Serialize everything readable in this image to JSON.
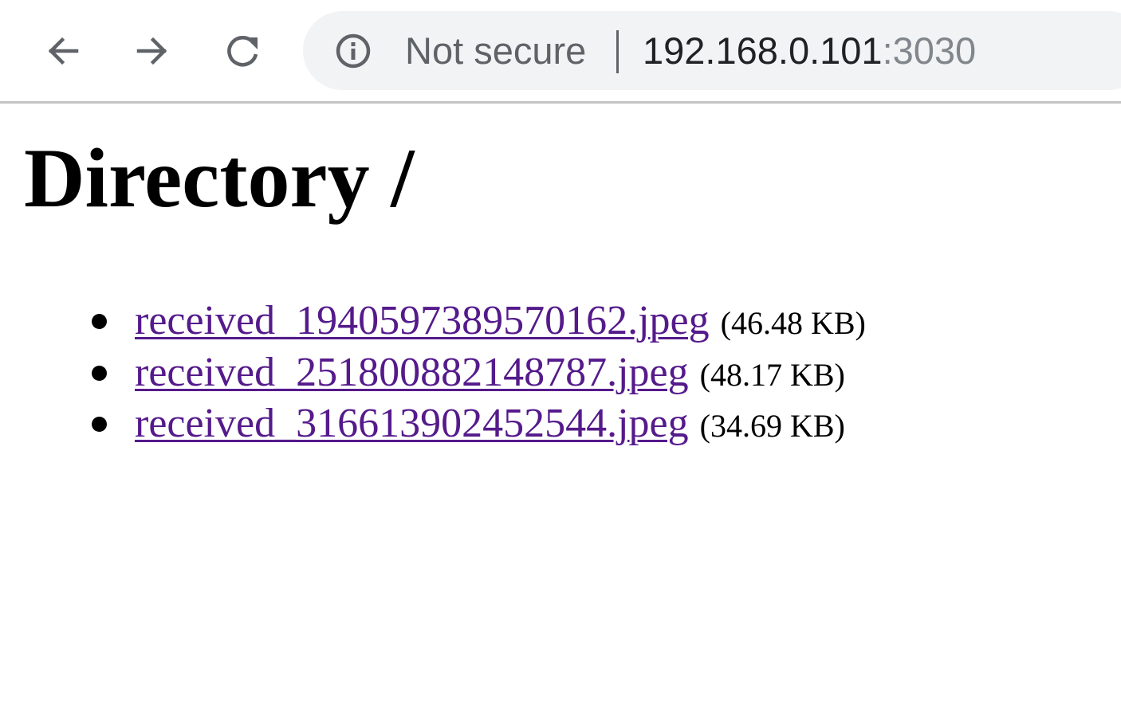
{
  "browser": {
    "security_label": "Not secure",
    "url_host": "192.168.0.101",
    "url_port": ":3030",
    "icons": {
      "back": "arrow-left",
      "forward": "arrow-right",
      "reload": "reload",
      "security": "info-circle"
    }
  },
  "page": {
    "title": "Directory /",
    "files": [
      {
        "name": "received_1940597389570162.jpeg",
        "size": "(46.48 KB)"
      },
      {
        "name": "received_251800882148787.jpeg",
        "size": "(48.17 KB)"
      },
      {
        "name": "received_316613902452544.jpeg",
        "size": "(34.69 KB)"
      }
    ]
  },
  "colors": {
    "link_visited": "#551a8b",
    "omnibox_bg": "#f1f3f4",
    "toolbar_icon": "#5f6368"
  }
}
